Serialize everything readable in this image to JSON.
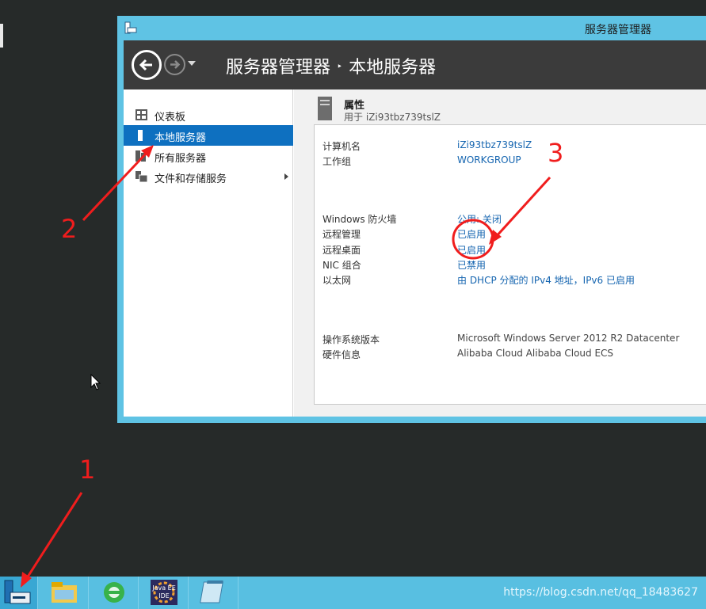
{
  "window": {
    "title": "服务器管理器",
    "breadcrumb": {
      "root": "服务器管理器",
      "separator": "‣",
      "current": "本地服务器"
    }
  },
  "sidebar": {
    "items": [
      {
        "label": "仪表板",
        "icon": "dashboard-icon",
        "active": false
      },
      {
        "label": "本地服务器",
        "icon": "server-icon",
        "active": true
      },
      {
        "label": "所有服务器",
        "icon": "servers-icon",
        "active": false
      },
      {
        "label": "文件和存储服务",
        "icon": "storage-icon",
        "active": false,
        "has_submenu": true
      }
    ]
  },
  "properties": {
    "title": "属性",
    "subtitle": "用于 iZi93tbz739tslZ",
    "rows": [
      {
        "label": "计算机名",
        "value": "iZi93tbz739tslZ",
        "link": true
      },
      {
        "label": "工作组",
        "value": "WORKGROUP",
        "link": true
      },
      {
        "label": "Windows 防火墙",
        "value": "公用: 关闭",
        "link": true
      },
      {
        "label": "远程管理",
        "value": "已启用",
        "link": true
      },
      {
        "label": "远程桌面",
        "value": "已启用",
        "link": true
      },
      {
        "label": "NIC 组合",
        "value": "已禁用",
        "link": true
      },
      {
        "label": "以太网",
        "value": "由 DHCP 分配的 IPv4 地址，IPv6 已启用",
        "link": true
      },
      {
        "label": "操作系统版本",
        "value": "Microsoft Windows Server 2012 R2 Datacenter",
        "link": false
      },
      {
        "label": "硬件信息",
        "value": "Alibaba Cloud Alibaba Cloud ECS",
        "link": false
      }
    ]
  },
  "annotations": {
    "step1": "1",
    "step2": "2",
    "step3": "3",
    "color": "#f01d1d"
  },
  "taskbar": {
    "items": [
      "server-manager-icon",
      "file-explorer-icon",
      "ie-browser-icon",
      "java-ee-ide-icon",
      "notepad-icon"
    ],
    "java_label_top": "Java EE",
    "java_label_bottom": "IDE",
    "watermark": "https://blog.csdn.net/qq_18483627"
  },
  "colors": {
    "accent": "#0e70c0",
    "window_frame": "#5fc3e4",
    "header": "#3b3b3b",
    "taskbar": "#58bfe1",
    "link": "#1565b0"
  }
}
